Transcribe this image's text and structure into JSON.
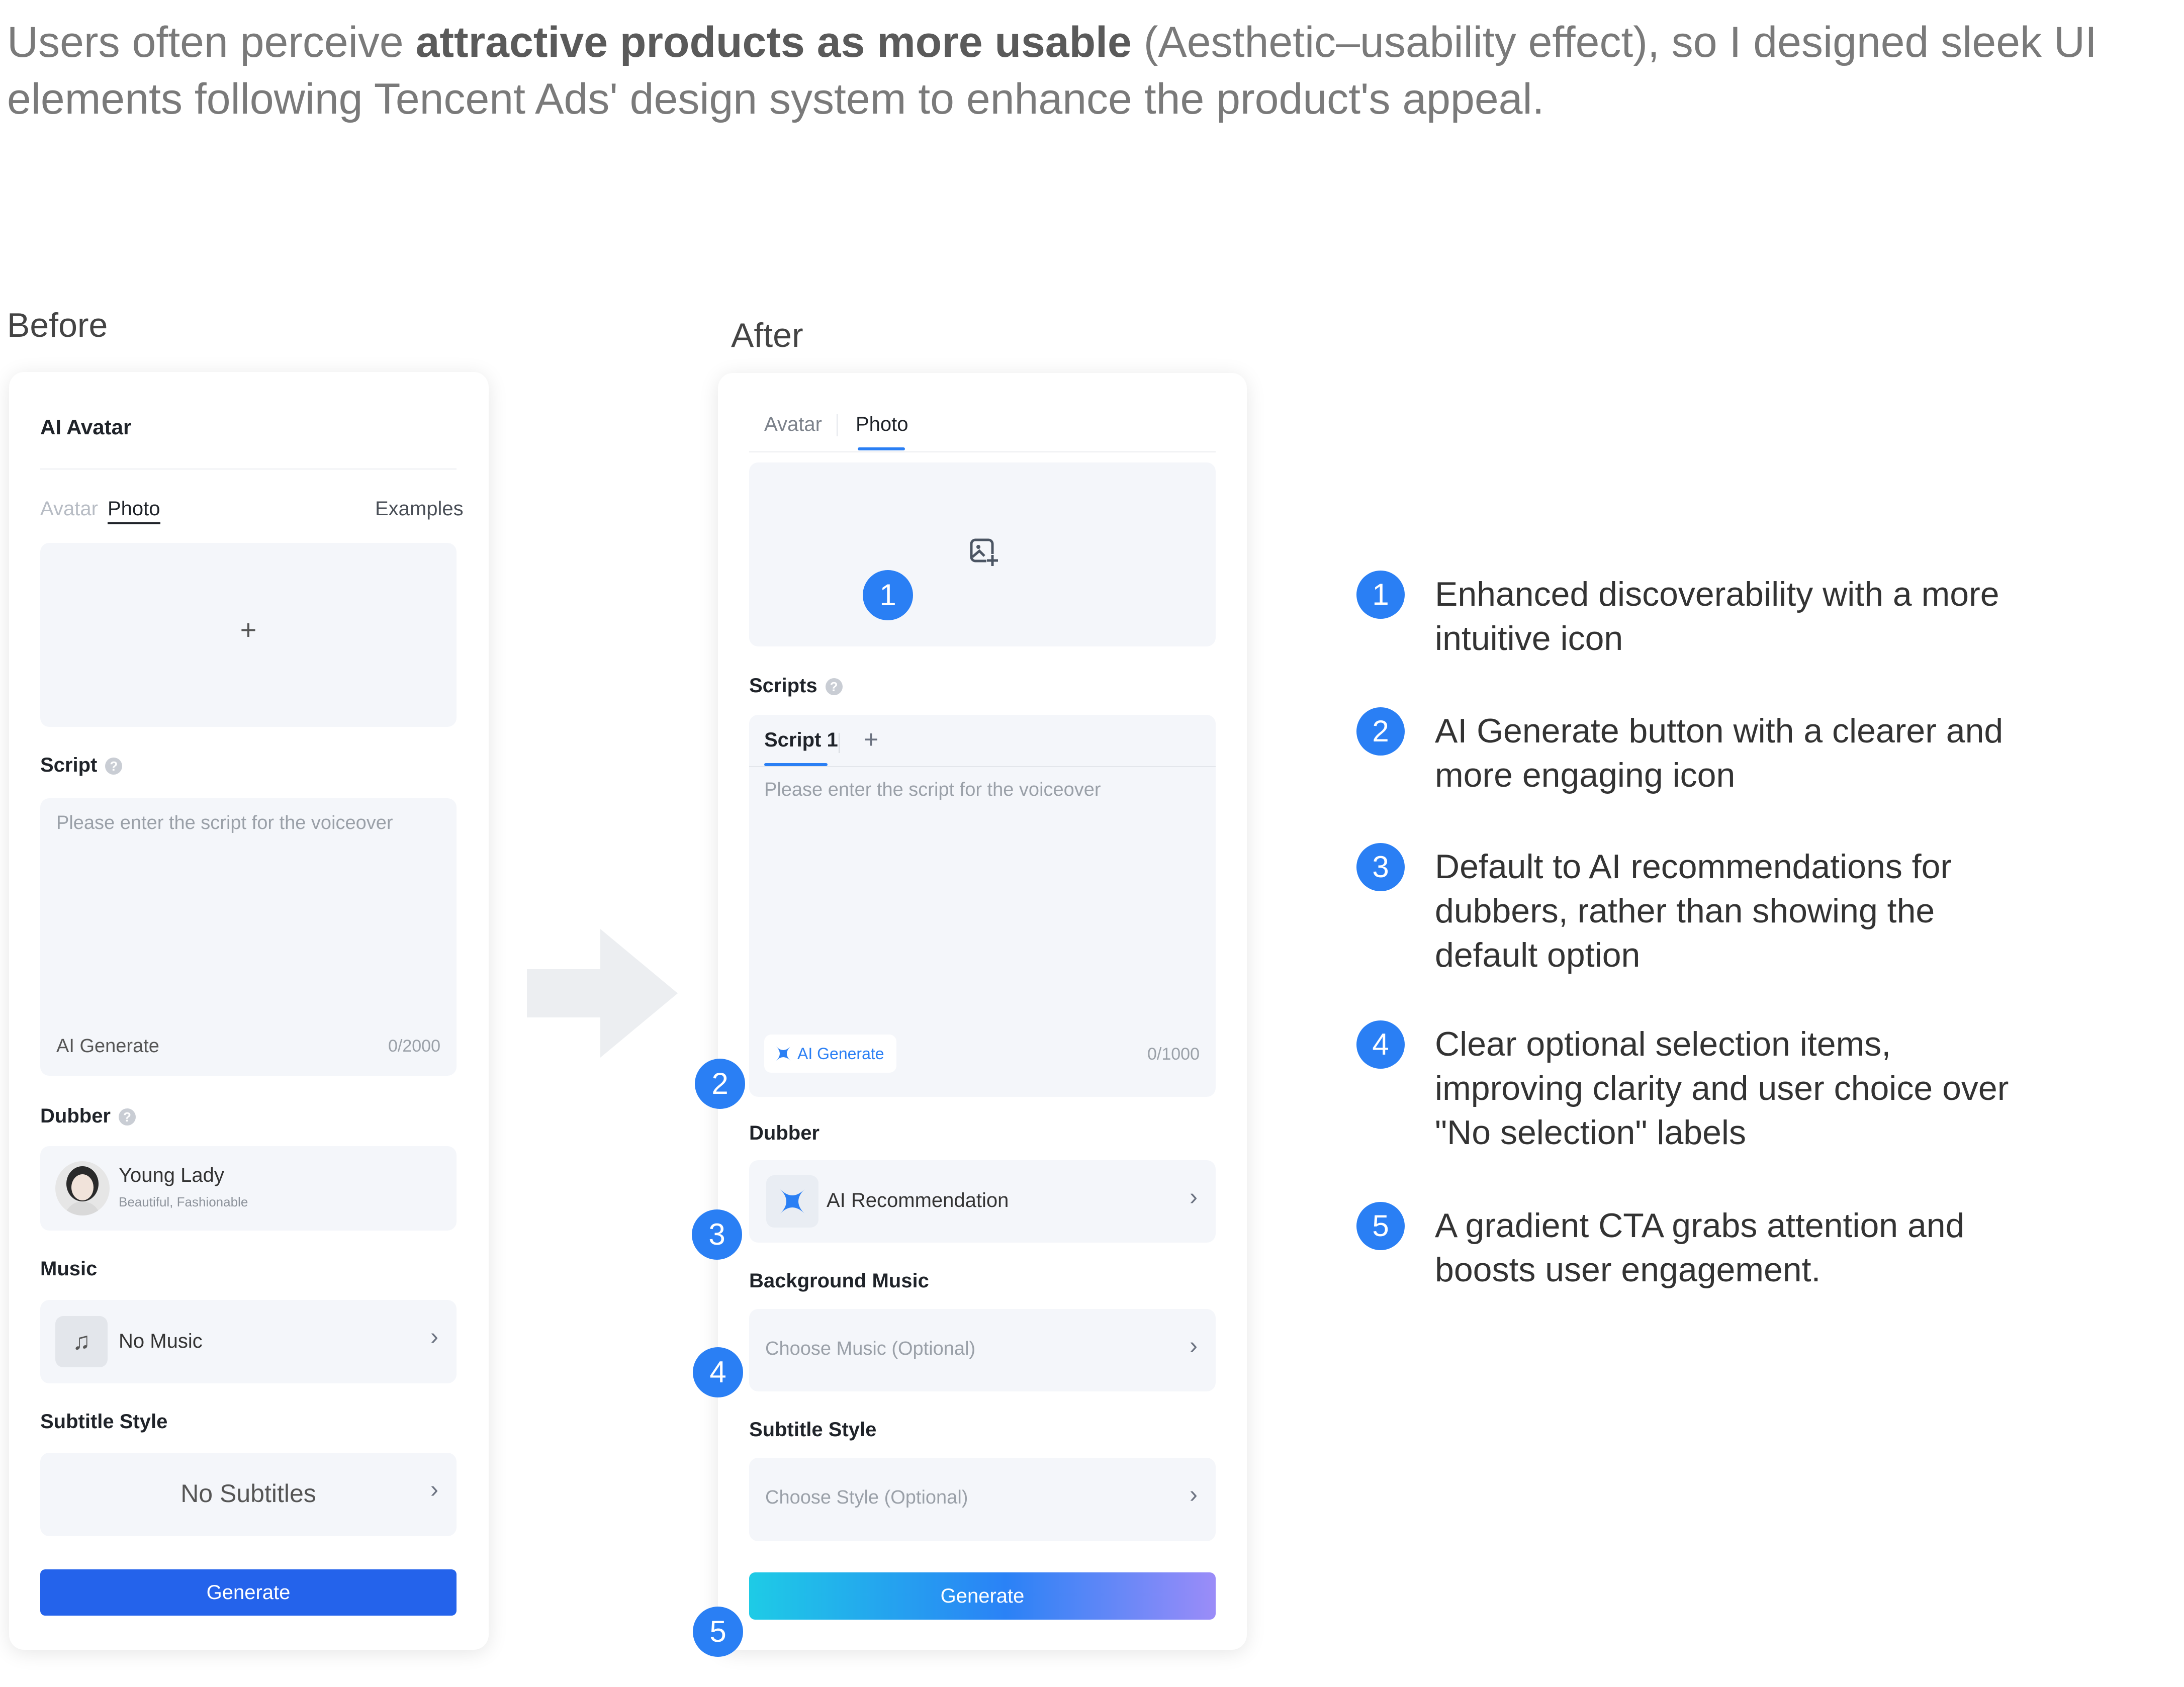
{
  "intro": {
    "pre": "Users often perceive ",
    "bold": "attractive products as more usable",
    "post": " (Aesthetic–usability effect), so I designed sleek UI elements following Tencent Ads' design system to enhance the product's appeal."
  },
  "before": {
    "section_label": "Before",
    "panel_title": "AI Avatar",
    "tabs": [
      "Avatar",
      "Photo"
    ],
    "examples_link": "Examples",
    "upload_plus": "+",
    "script_label": "Script",
    "help_mark": "?",
    "script_placeholder": "Please enter the script for the voiceover",
    "ai_generate": "AI Generate",
    "char_count": "0/2000",
    "dubber_label": "Dubber",
    "dubber_name": "Young Lady",
    "dubber_tags": "Beautiful, Fashionable",
    "music_label": "Music",
    "music_value": "No Music",
    "subtitle_label": "Subtitle Style",
    "subtitle_value": "No Subtitles",
    "chevron": "›",
    "generate": "Generate"
  },
  "after": {
    "section_label": "After",
    "tabs": [
      "Avatar",
      "Photo"
    ],
    "scripts_label": "Scripts",
    "help_mark": "?",
    "script_tab": "Script 1",
    "add_tab": "+",
    "script_placeholder": "Please enter the script for the voiceover",
    "ai_generate": "AI Generate",
    "char_count": "0/1000",
    "dubber_label": "Dubber",
    "dubber_value": "AI Recommendation",
    "music_label": "Background Music",
    "music_placeholder": "Choose Music (Optional)",
    "subtitle_label": "Subtitle Style",
    "subtitle_placeholder": "Choose Style (Optional)",
    "chevron": "›",
    "generate": "Generate"
  },
  "badges": [
    "1",
    "2",
    "3",
    "4",
    "5"
  ],
  "notes": [
    {
      "num": "1",
      "lines": [
        "Enhanced discoverability with a more",
        "intuitive icon"
      ]
    },
    {
      "num": "2",
      "lines": [
        "AI Generate button with a clearer and",
        "more engaging icon"
      ]
    },
    {
      "num": "3",
      "lines": [
        "Default to AI recommendations for",
        "dubbers, rather than showing the",
        "default option"
      ]
    },
    {
      "num": "4",
      "lines": [
        "Clear optional selection items,",
        "improving clarity and user choice over",
        "\"No selection\" labels"
      ]
    },
    {
      "num": "5",
      "lines": [
        "A gradient CTA grabs attention and",
        "boosts user engagement."
      ]
    }
  ],
  "colors": {
    "accent": "#2a7ff4",
    "before_button": "#2463eb",
    "after_gradient": [
      "#1ecbe6",
      "#2a82f6",
      "#9b8cf8"
    ],
    "field_bg": "#f4f6fa"
  },
  "icons": [
    "image-add-icon",
    "sparkle-icon",
    "music-note-icon",
    "chevron-right-icon",
    "arrow-right-icon"
  ]
}
